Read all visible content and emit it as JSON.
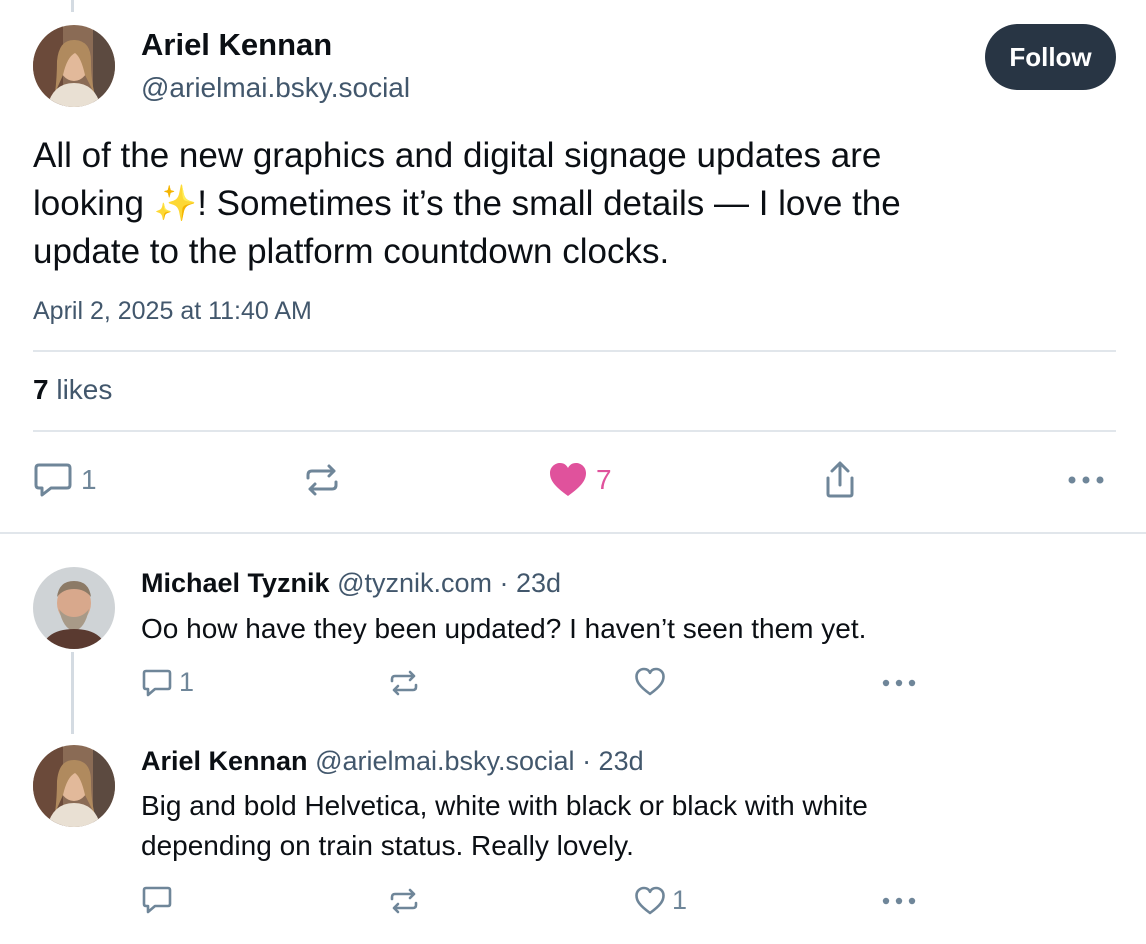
{
  "post": {
    "author_name": "Ariel Kennan",
    "author_handle": "@arielmai.bsky.social",
    "follow_label": "Follow",
    "text_lines": [
      "All of the new graphics and digital signage updates are",
      "looking ✨! Sometimes it’s the small details — I love the",
      "update to the platform countdown clocks."
    ],
    "date": "April 2, 2025 at 11:40 AM",
    "likes_count": "7",
    "likes_label": "likes",
    "actions": {
      "reply_count": "1",
      "repost_count": "",
      "like_count": "7"
    },
    "colors": {
      "like_active": "#e0529c",
      "follow_bg": "#283544",
      "muted": "#6f8699"
    }
  },
  "replies": [
    {
      "author_name": "Michael Tyznik",
      "author_handle": "@tyznik.com",
      "age": "· 23d",
      "text_lines": [
        "Oo how have they been updated? I haven’t seen them yet."
      ],
      "reply_count": "1",
      "like_count": ""
    },
    {
      "author_name": "Ariel Kennan",
      "author_handle": "@arielmai.bsky.social",
      "age": "· 23d",
      "text_lines": [
        "Big and bold Helvetica, white with black or black with white",
        "depending on train status. Really lovely."
      ],
      "reply_count": "",
      "like_count": "1"
    }
  ],
  "icons": {
    "reply": "speech-bubble-icon",
    "repost": "repost-arrows-icon",
    "like": "heart-icon",
    "share": "share-icon",
    "more": "ellipsis-icon"
  }
}
